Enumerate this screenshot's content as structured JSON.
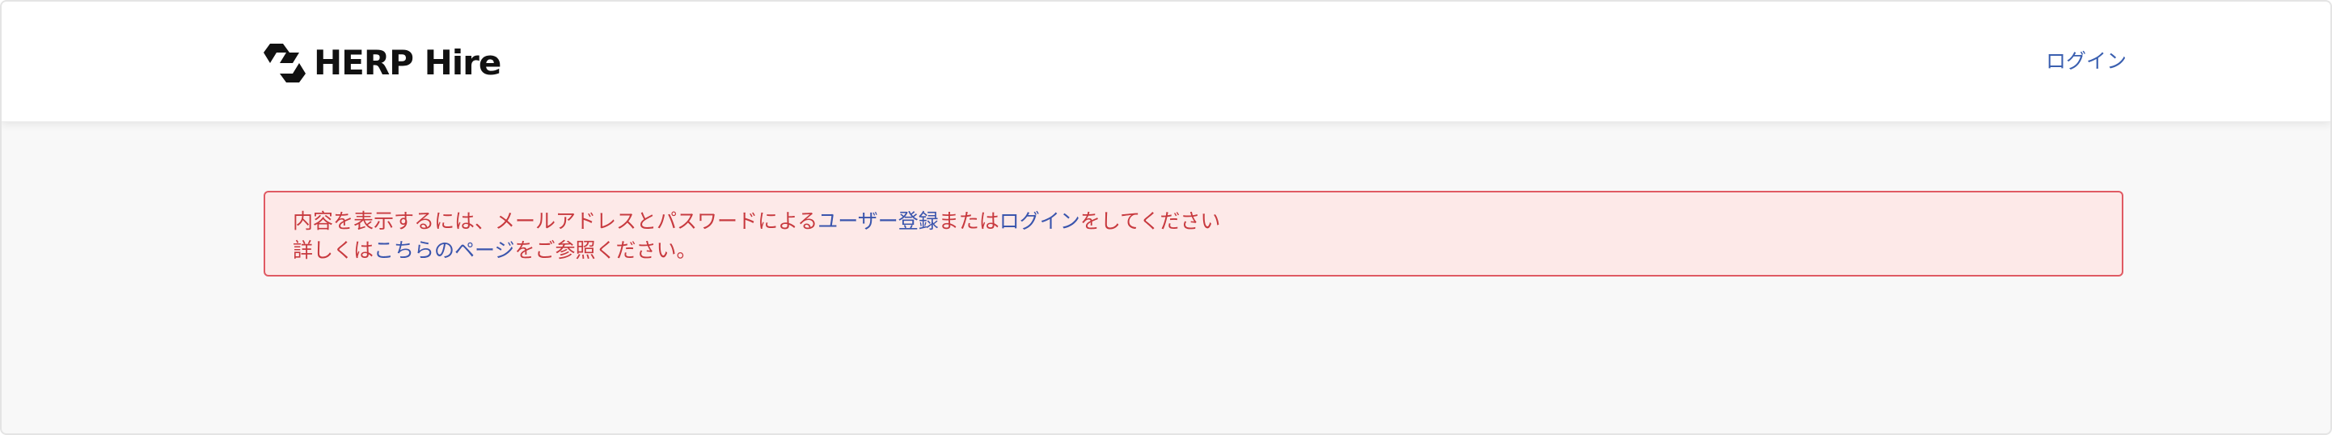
{
  "header": {
    "brand_name": "HERP Hire",
    "logo_icon": "herp-logo-mark",
    "login_label": "ログイン"
  },
  "alert": {
    "line1_prefix": "内容を表示するには、メールアドレスとパスワードによる",
    "line1_signup_link": "ユーザー登録",
    "line1_middle": "または",
    "line1_login_link": "ログイン",
    "line1_suffix": "をしてください",
    "line2_prefix": "詳しくは",
    "line2_link": "こちらのページ",
    "line2_suffix": "をご参照ください。"
  },
  "colors": {
    "page_background": "#f8f8f8",
    "header_background": "#ffffff",
    "alert_background": "#fde9e8",
    "alert_border": "#e05a63",
    "alert_text": "#c83a3f",
    "link": "#3a55ad"
  }
}
